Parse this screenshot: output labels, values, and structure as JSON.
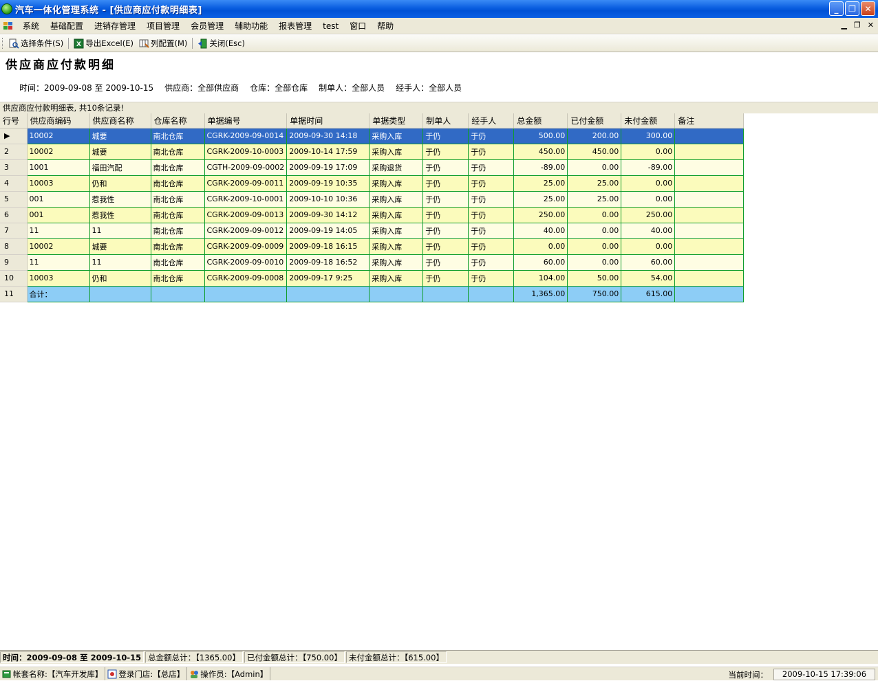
{
  "window": {
    "title": "汽车一体化管理系统 - [供应商应付款明细表]",
    "minimize": "_",
    "restore": "❐",
    "close": "✕"
  },
  "menu": {
    "items": [
      "系统",
      "基础配置",
      "进销存管理",
      "项目管理",
      "会员管理",
      "辅助功能",
      "报表管理",
      "test",
      "窗口",
      "帮助"
    ],
    "mdi_min": "▁",
    "mdi_restore": "❐",
    "mdi_close": "✕"
  },
  "toolbar": {
    "select_condition": "选择条件(S)",
    "export_excel": "导出Excel(E)",
    "column_config": "列配置(M)",
    "close": "关闭(Esc)"
  },
  "report": {
    "title": "供应商应付款明细",
    "criteria": {
      "time": "时间：2009-09-08 至 2009-10-15",
      "supplier": "供应商：全部供应商",
      "warehouse": "仓库：全部仓库",
      "creator": "制单人：全部人员",
      "handler": "经手人：全部人员"
    },
    "caption": "供应商应付款明细表, 共10条记录!"
  },
  "grid": {
    "headers": [
      "行号",
      "供应商编码",
      "供应商名称",
      "仓库名称",
      "单据编号",
      "单据时间",
      "单据类型",
      "制单人",
      "经手人",
      "总金额",
      "已付金额",
      "未付金额",
      "备注"
    ],
    "rows": [
      [
        "▶",
        "10002",
        "城要",
        "南北仓库",
        "CGRK-2009-09-0014",
        "2009-09-30 14:18",
        "采购入库",
        "于仍",
        "于仍",
        "500.00",
        "200.00",
        "300.00",
        ""
      ],
      [
        "2",
        "10002",
        "城要",
        "南北仓库",
        "CGRK-2009-10-0003",
        "2009-10-14 17:59",
        "采购入库",
        "于仍",
        "于仍",
        "450.00",
        "450.00",
        "0.00",
        ""
      ],
      [
        "3",
        "1001",
        "福田汽配",
        "南北仓库",
        "CGTH-2009-09-0002",
        "2009-09-19 17:09",
        "采购退货",
        "于仍",
        "于仍",
        "-89.00",
        "0.00",
        "-89.00",
        ""
      ],
      [
        "4",
        "10003",
        "仍和",
        "南北仓库",
        "CGRK-2009-09-0011",
        "2009-09-19 10:35",
        "采购入库",
        "于仍",
        "于仍",
        "25.00",
        "25.00",
        "0.00",
        ""
      ],
      [
        "5",
        "001",
        "惹我性",
        "南北仓库",
        "CGRK-2009-10-0001",
        "2009-10-10 10:36",
        "采购入库",
        "于仍",
        "于仍",
        "25.00",
        "25.00",
        "0.00",
        ""
      ],
      [
        "6",
        "001",
        "惹我性",
        "南北仓库",
        "CGRK-2009-09-0013",
        "2009-09-30 14:12",
        "采购入库",
        "于仍",
        "于仍",
        "250.00",
        "0.00",
        "250.00",
        ""
      ],
      [
        "7",
        "11",
        "11",
        "南北仓库",
        "CGRK-2009-09-0012",
        "2009-09-19 14:05",
        "采购入库",
        "于仍",
        "于仍",
        "40.00",
        "0.00",
        "40.00",
        ""
      ],
      [
        "8",
        "10002",
        "城要",
        "南北仓库",
        "CGRK-2009-09-0009",
        "2009-09-18 16:15",
        "采购入库",
        "于仍",
        "于仍",
        "0.00",
        "0.00",
        "0.00",
        ""
      ],
      [
        "9",
        "11",
        "11",
        "南北仓库",
        "CGRK-2009-09-0010",
        "2009-09-18 16:52",
        "采购入库",
        "于仍",
        "于仍",
        "60.00",
        "0.00",
        "60.00",
        ""
      ],
      [
        "10",
        "10003",
        "仍和",
        "南北仓库",
        "CGRK-2009-09-0008",
        "2009-09-17 9:25",
        "采购入库",
        "于仍",
        "于仍",
        "104.00",
        "50.00",
        "54.00",
        ""
      ]
    ],
    "total_row": [
      "11",
      "合计：",
      "",
      "",
      "",
      "",
      "",
      "",
      "",
      "1,365.00",
      "750.00",
      "615.00",
      ""
    ]
  },
  "status": {
    "time": "时间：2009-09-08 至 2009-10-15",
    "total_amount": "总金额总计：【1365.00】",
    "paid_amount": "已付金额总计：【750.00】",
    "unpaid_amount": "未付金额总计：【615.00】",
    "account": "帐套名称:【汽车开发库】",
    "store": "登录门店:【总店】",
    "operator": "操作员:【Admin】",
    "current_time_label": "当前时间：",
    "current_time": "2009-10-15 17:39:06"
  },
  "colors": {
    "selection": "#316ac5",
    "row_odd": "#fefde3",
    "row_even": "#fbfbbc",
    "total_row": "#8dcdf6",
    "grid_line": "#0f9d2c"
  }
}
